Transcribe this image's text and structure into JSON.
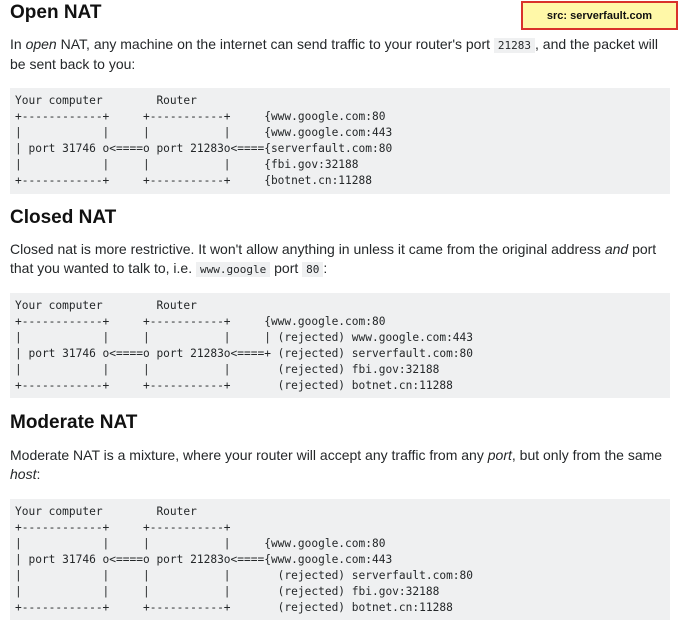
{
  "source_badge": "src: serverfault.com",
  "sections": [
    {
      "heading": "Open NAT",
      "para_parts": [
        {
          "text": "In ",
          "style": "plain"
        },
        {
          "text": "open",
          "style": "italic"
        },
        {
          "text": " NAT, any machine on the internet can send traffic to your router's port ",
          "style": "plain"
        },
        {
          "text": "21283",
          "style": "code"
        },
        {
          "text": ", and the packet will be sent back to you:",
          "style": "plain"
        }
      ],
      "code_lines": [
        "Your computer        Router",
        "+------------+     +-----------+     {www.google.com:80",
        "|            |     |           |     {www.google.com:443",
        "| port 31746 o<====o port 21283o<===={serverfault.com:80",
        "|            |     |           |     {fbi.gov:32188",
        "+------------+     +-----------+     {botnet.cn:11288"
      ]
    },
    {
      "heading": "Closed NAT",
      "para_parts": [
        {
          "text": "Closed nat is more restrictive. It won't allow anything in unless it came from the original address ",
          "style": "plain"
        },
        {
          "text": "and",
          "style": "italic"
        },
        {
          "text": " port that you wanted to talk to, i.e. ",
          "style": "plain"
        },
        {
          "text": "www.google",
          "style": "code"
        },
        {
          "text": " port ",
          "style": "plain"
        },
        {
          "text": "80",
          "style": "code"
        },
        {
          "text": ":",
          "style": "plain"
        }
      ],
      "code_lines": [
        "Your computer        Router",
        "+------------+     +-----------+     {www.google.com:80",
        "|            |     |           |     | (rejected) www.google.com:443",
        "| port 31746 o<====o port 21283o<====+ (rejected) serverfault.com:80",
        "|            |     |           |       (rejected) fbi.gov:32188",
        "+------------+     +-----------+       (rejected) botnet.cn:11288"
      ]
    },
    {
      "heading": "Moderate NAT",
      "para_parts": [
        {
          "text": "Moderate NAT is a mixture, where your router will accept any traffic from any ",
          "style": "plain"
        },
        {
          "text": "port",
          "style": "italic"
        },
        {
          "text": ", but only from the same ",
          "style": "plain"
        },
        {
          "text": "host",
          "style": "italic"
        },
        {
          "text": ":",
          "style": "plain"
        }
      ],
      "code_lines": [
        "Your computer        Router",
        "+------------+     +-----------+",
        "|            |     |           |     {www.google.com:80",
        "| port 31746 o<====o port 21283o<===={www.google.com:443",
        "|            |     |           |       (rejected) serverfault.com:80",
        "|            |     |           |       (rejected) fbi.gov:32188",
        "+------------+     +-----------+       (rejected) botnet.cn:11288"
      ]
    }
  ]
}
